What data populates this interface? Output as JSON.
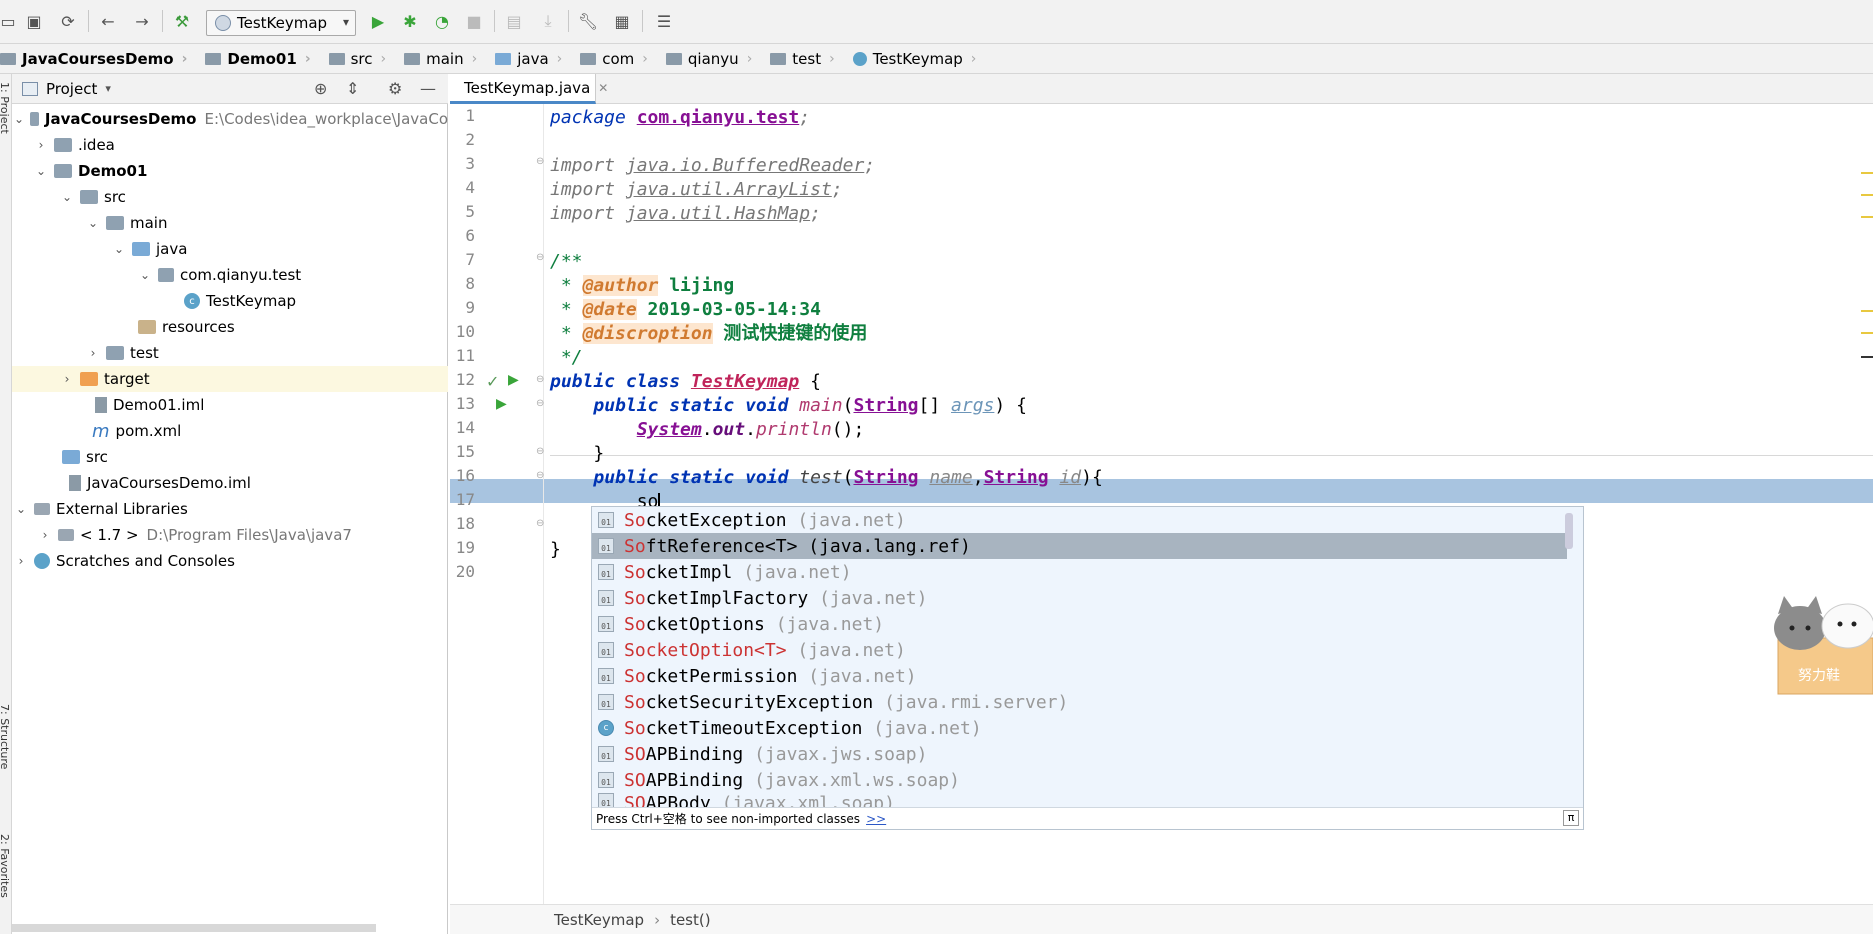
{
  "toolbar": {
    "run_config": "TestKeymap",
    "icons": [
      "folder-open-icon",
      "save-icon",
      "sync-icon",
      "back-icon",
      "forward-icon",
      "build-icon",
      "run-icon",
      "debug-icon",
      "coverage-icon",
      "stop-icon",
      "update-icon",
      "download-icon",
      "wrench-icon",
      "project-structure-icon",
      "sdk-icon"
    ]
  },
  "breadcrumbs": [
    "JavaCoursesDemo",
    "Demo01",
    "src",
    "main",
    "java",
    "com",
    "qianyu",
    "test",
    "TestKeymap"
  ],
  "left_stripe": {
    "project_label": "1: Project",
    "structure_label": "7: Structure",
    "favorites_label": "2: Favorites"
  },
  "project_panel": {
    "title": "Project",
    "tree": [
      {
        "label": "JavaCoursesDemo",
        "path": "E:\\Codes\\idea_workplace\\JavaCo",
        "bold": true
      },
      {
        "label": ".idea"
      },
      {
        "label": "Demo01",
        "bold": true
      },
      {
        "label": "src"
      },
      {
        "label": "main"
      },
      {
        "label": "java"
      },
      {
        "label": "com.qianyu.test"
      },
      {
        "label": "TestKeymap"
      },
      {
        "label": "resources"
      },
      {
        "label": "test"
      },
      {
        "label": "target"
      },
      {
        "label": "Demo01.iml"
      },
      {
        "label": "pom.xml"
      },
      {
        "label": "src"
      },
      {
        "label": "JavaCoursesDemo.iml"
      },
      {
        "label": "External Libraries"
      },
      {
        "label": "< 1.7 >",
        "path": "D:\\Program Files\\Java\\java7"
      },
      {
        "label": "Scratches and Consoles"
      }
    ]
  },
  "editor": {
    "tab_label": "TestKeymap.java",
    "line_numbers": [
      "1",
      "2",
      "3",
      "4",
      "5",
      "6",
      "7",
      "8",
      "9",
      "10",
      "11",
      "12",
      "13",
      "14",
      "15",
      "16",
      "17",
      "18",
      "19",
      "20"
    ],
    "code": {
      "l1_kw": "package",
      "l1_pkg": "com.qianyu.test",
      "l3_kw": "import",
      "l3_pkg": "java.io.BufferedReader",
      "l4_pkg": "java.util.ArrayList",
      "l5_pkg": "java.util.HashMap",
      "l7": "/**",
      "author_tag": "@author",
      "author": " lijing",
      "date_tag": "@date",
      "date": " 2019-03-05-14:34",
      "disc_tag": "@discroption",
      "disc": " 测试快捷键的使用",
      "l11": " */",
      "class_name": "TestKeymap",
      "main_sig": "main",
      "string_type": "String",
      "args": "args",
      "system": "System",
      "out": "out",
      "println": "println",
      "test_sig": "test",
      "name": "name",
      "id": "id",
      "typed": "so"
    }
  },
  "autocomplete": {
    "items": [
      {
        "match": "So",
        "rest": "cketException",
        "pkg": "(java.net)"
      },
      {
        "match": "So",
        "rest": "ftReference<T>",
        "pkg": "(java.lang.ref)"
      },
      {
        "match": "So",
        "rest": "cketImpl",
        "pkg": "(java.net)"
      },
      {
        "match": "So",
        "rest": "cketImplFactory",
        "pkg": "(java.net)"
      },
      {
        "match": "So",
        "rest": "cketOptions",
        "pkg": "(java.net)"
      },
      {
        "match": "So",
        "rest": "cketOption<T>",
        "pkg": "(java.net)"
      },
      {
        "match": "So",
        "rest": "cketPermission",
        "pkg": "(java.net)"
      },
      {
        "match": "So",
        "rest": "cketSecurityException",
        "pkg": "(java.rmi.server)"
      },
      {
        "match": "So",
        "rest": "cketTimeoutException",
        "pkg": "(java.net)"
      },
      {
        "match": "SO",
        "rest": "APBinding",
        "pkg": "(javax.jws.soap)"
      },
      {
        "match": "SO",
        "rest": "APBinding",
        "pkg": "(javax.xml.ws.soap)"
      },
      {
        "match": "SO",
        "rest": "APBody",
        "pkg": "(javax.xml.soap)"
      }
    ],
    "footer_text": "Press Ctrl+空格 to see non-imported classes",
    "footer_link": ">>",
    "pi_icon": "π"
  },
  "status": {
    "class": "TestKeymap",
    "method": "test()"
  },
  "sticker": {
    "text": "努力鞋"
  }
}
